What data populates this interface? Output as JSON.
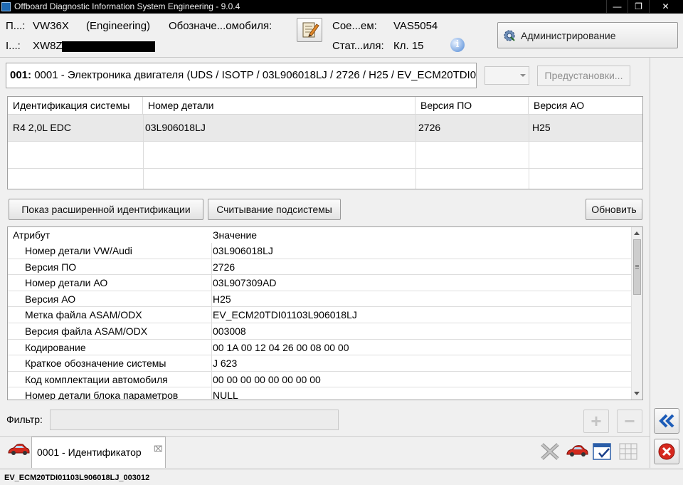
{
  "window": {
    "title": "Offboard Diagnostic Information System Engineering - 9.0.4",
    "minimize_glyph": "—",
    "restore_glyph": "❐",
    "close_glyph": "✕"
  },
  "header": {
    "project_label": "П...:",
    "project_value": "VW36X",
    "mode_value": "(Engineering)",
    "designation_label": "Обозначе...омобиля:",
    "vin_label": "I...:",
    "vin_value": "XW8Z",
    "connection_label": "Сое...ем:",
    "connection_value": "VAS5054",
    "status_label": "Стат...иля:",
    "status_value": "Кл. 15",
    "admin_button": "Администрирование"
  },
  "ecu": {
    "address": "001:",
    "description": "0001 - Электроника двигателя  (UDS / ISOTP / 03L906018LJ / 2726 / H25 / EV_ECM20TDI0",
    "preset_button": "Предустановки..."
  },
  "ident_table": {
    "columns": [
      "Идентификация системы",
      "Номер детали",
      "Версия ПО",
      "Версия АО"
    ],
    "rows": [
      [
        "R4 2,0L EDC",
        "03L906018LJ",
        "2726",
        "H25"
      ]
    ]
  },
  "buttons": {
    "extended_ident": "Показ расширенной идентификации",
    "read_subsystem": "Считывание подсистемы",
    "refresh": "Обновить"
  },
  "attributes": {
    "columns": [
      "Атрибут",
      "Значение"
    ],
    "rows": [
      {
        "attr": "Номер детали VW/Audi",
        "value": "03L906018LJ"
      },
      {
        "attr": "Версия ПО",
        "value": "2726"
      },
      {
        "attr": "Номер детали АО",
        "value": "03L907309AD"
      },
      {
        "attr": "Версия АО",
        "value": "H25"
      },
      {
        "attr": "Метка файла ASAM/ODX",
        "value": "EV_ECM20TDI01103L906018LJ"
      },
      {
        "attr": "Версия файла ASAM/ODX",
        "value": "003008"
      },
      {
        "attr": "Кодирование",
        "value": "00 1A 00 12 04 26 00 08 00 00"
      },
      {
        "attr": "Краткое обозначение системы",
        "value": "J 623"
      },
      {
        "attr": "Код комплектации автомобиля",
        "value": "00 00 00 00 00 00 00 00"
      },
      {
        "attr": "Номер детали блока параметров",
        "value": "NULL"
      }
    ]
  },
  "filter": {
    "label": "Фильтр:",
    "value": "",
    "add_glyph": "+",
    "remove_glyph": "−"
  },
  "tabs": {
    "active_label": "0001 - Идентификатор",
    "close_glyph": "⌧"
  },
  "status_bar": {
    "text": "EV_ECM20TDI01103L906018LJ_003012"
  }
}
